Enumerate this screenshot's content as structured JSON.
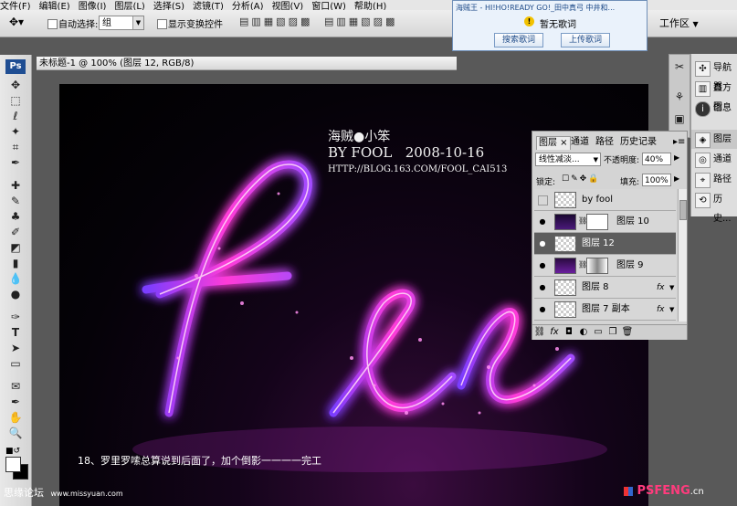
{
  "menu": [
    "文件(F)",
    "编辑(E)",
    "图像(I)",
    "图层(L)",
    "选择(S)",
    "滤镜(T)",
    "分析(A)",
    "视图(V)",
    "窗口(W)",
    "帮助(H)"
  ],
  "options": {
    "auto_select_label": "自动选择:",
    "auto_select_value": "组",
    "transform_label": "显示变换控件"
  },
  "popup": {
    "line1": "海贼王 - HI!HO!READY GO!_田中真弓 中井和...",
    "status": "暂无歌词",
    "search_btn": "搜索歌词",
    "upload_btn": "上传歌词"
  },
  "workspace_label": "工作区",
  "document_title": "未标题-1 @ 100% (图层 12, RGB/8)",
  "toolbox_logo": "Ps",
  "canvas": {
    "wm_name": "海贼●小笨",
    "wm_by": "BY FOOL   2008-10-16",
    "wm_url": "HTTP://BLOG.163.COM/FOOL_CAI513",
    "caption": "18、罗里罗嗦总算说到后面了，加个倒影一一一一完工"
  },
  "dock": {
    "items": [
      "导航器",
      "直方图",
      "信息",
      "图层",
      "通道",
      "路径",
      "历史..."
    ]
  },
  "layers_panel": {
    "tabs": [
      "图层",
      "通道",
      "路径",
      "历史记录"
    ],
    "blend_mode": "线性减淡...",
    "opacity_label": "不透明度:",
    "opacity_value": "40%",
    "lock_label": "锁定:",
    "fill_label": "填充:",
    "fill_value": "100%",
    "layers": [
      {
        "name": "by fool",
        "visible": false,
        "selected": false,
        "fx": false
      },
      {
        "name": "图层 10",
        "visible": true,
        "selected": false,
        "fx": false
      },
      {
        "name": "图层 12",
        "visible": true,
        "selected": true,
        "fx": false
      },
      {
        "name": "图层 9",
        "visible": true,
        "selected": false,
        "fx": false
      },
      {
        "name": "图层 8",
        "visible": true,
        "selected": false,
        "fx": true
      },
      {
        "name": "图层 7 副本",
        "visible": true,
        "selected": false,
        "fx": true
      }
    ],
    "fx_label": "fx"
  },
  "footer": {
    "left": "思缘论坛",
    "left_url": "www.missyuan.com",
    "right_brand": "PSFENG",
    "right_tld": ".cn"
  },
  "colors": {
    "glow_magenta": "#ff3bd8",
    "glow_violet": "#7a3cff",
    "selected_layer": "#5d5d5d"
  }
}
